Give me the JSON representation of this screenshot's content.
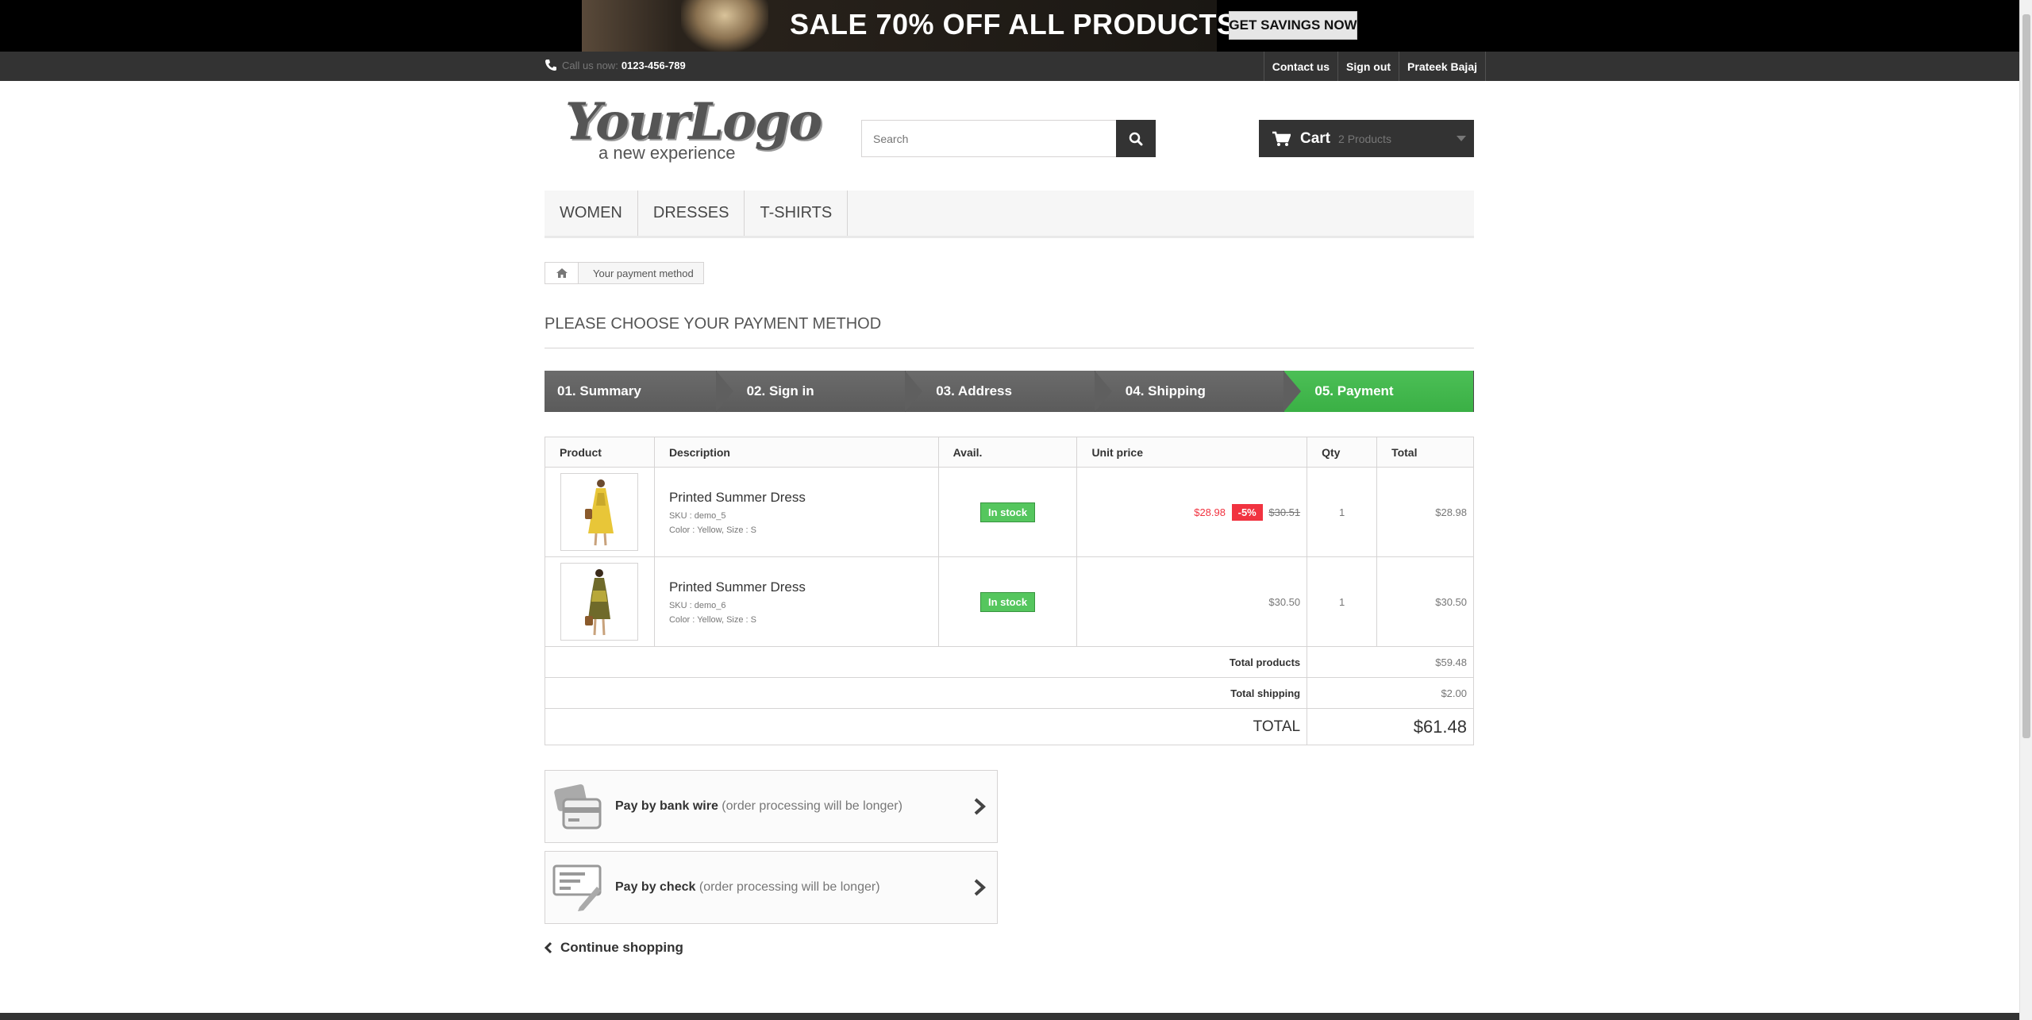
{
  "banner": {
    "text": "SALE 70% OFF ALL PRODUCTS",
    "button": "GET SAVINGS NOW"
  },
  "header_nav": {
    "call_label": "Call us now:",
    "phone": "0123-456-789",
    "links": [
      "Contact us",
      "Sign out",
      "Prateek Bajaj"
    ]
  },
  "logo": {
    "main": "YourLogo",
    "sub": "a new experience"
  },
  "search": {
    "placeholder": "Search"
  },
  "cart": {
    "title": "Cart",
    "quantity": "2 Products"
  },
  "menu": [
    "Women",
    "Dresses",
    "T-shirts"
  ],
  "breadcrumb": {
    "current": "Your payment method"
  },
  "page_heading": "Please choose your payment method",
  "steps": [
    "01. Summary",
    "02. Sign in",
    "03. Address",
    "04. Shipping",
    "05. Payment"
  ],
  "active_step": "05. Payment",
  "table": {
    "headers": [
      "Product",
      "Description",
      "Avail.",
      "Unit price",
      "Qty",
      "Total"
    ],
    "rows": [
      {
        "name": "Printed Summer Dress",
        "sku": "SKU : demo_5",
        "attributes": "Color : Yellow, Size : S",
        "availability": "In stock",
        "special_price": "$28.98",
        "reduction": "-5%",
        "old_price": "$30.51",
        "qty": "1",
        "total": "$28.98"
      },
      {
        "name": "Printed Summer Dress",
        "sku": "SKU : demo_6",
        "attributes": "Color : Yellow, Size : S",
        "availability": "In stock",
        "price": "$30.50",
        "qty": "1",
        "total": "$30.50"
      }
    ],
    "totals": {
      "products_label": "Total products",
      "products_value": "$59.48",
      "shipping_label": "Total shipping",
      "shipping_value": "$2.00",
      "total_label": "TOTAL",
      "total_value": "$61.48"
    }
  },
  "payment_options": [
    {
      "label": "Pay by bank wire",
      "note": "(order processing will be longer)",
      "icon": "bank-card-icon"
    },
    {
      "label": "Pay by check",
      "note": "(order processing will be longer)",
      "icon": "check-icon"
    }
  ],
  "continue_label": "Continue shopping",
  "colors": {
    "accent_green": "#46b84f",
    "dark": "#333333",
    "sale_red": "#f13340"
  }
}
